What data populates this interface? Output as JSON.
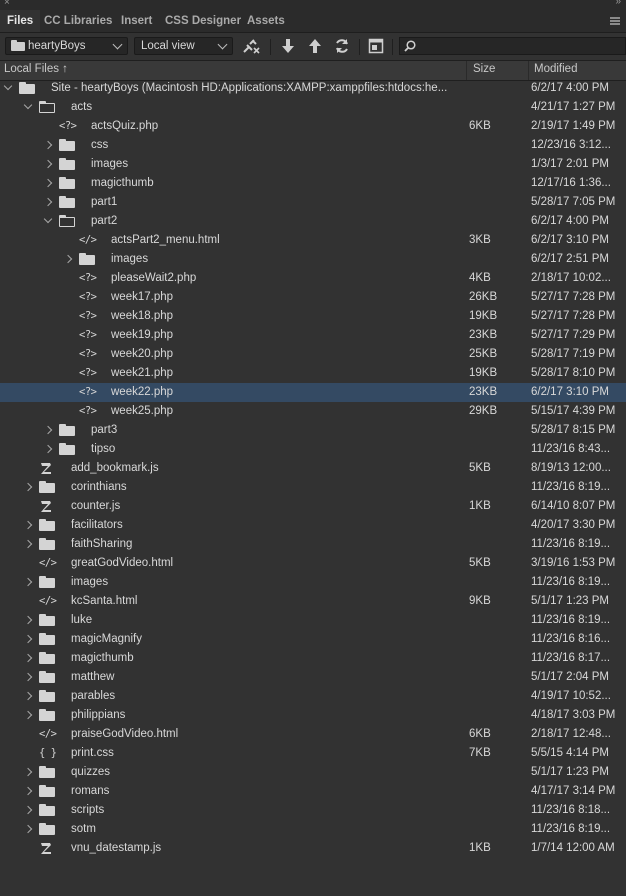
{
  "tabs": [
    "Files",
    "CC Libraries",
    "Insert",
    "CSS Designer",
    "Assets"
  ],
  "toolbar": {
    "site": "heartyBoys",
    "view": "Local view",
    "search_value": ""
  },
  "columns": {
    "local_files": "Local Files",
    "sort_arrow": "↑",
    "size": "Size",
    "modified": "Modified"
  },
  "rows": [
    {
      "name": "Site - heartyBoys (Macintosh HD:Applications:XAMPP:xamppfiles:htdocs:he...",
      "size": "",
      "modified": "6/2/17 4:00 PM",
      "icon": "site-folder-icon",
      "level": 0,
      "expand": "open"
    },
    {
      "name": "acts",
      "size": "",
      "modified": "4/21/17 1:27 PM",
      "icon": "folder-open-icon",
      "level": 1,
      "expand": "open"
    },
    {
      "name": "actsQuiz.php",
      "size": "6KB",
      "modified": "2/19/17 1:49 PM",
      "icon": "php-file-icon",
      "level": 2,
      "expand": ""
    },
    {
      "name": "css",
      "size": "",
      "modified": "12/23/16 3:12...",
      "icon": "folder-icon",
      "level": 2,
      "expand": "closed"
    },
    {
      "name": "images",
      "size": "",
      "modified": "1/3/17 2:01 PM",
      "icon": "folder-icon",
      "level": 2,
      "expand": "closed"
    },
    {
      "name": "magicthumb",
      "size": "",
      "modified": "12/17/16 1:36...",
      "icon": "folder-icon",
      "level": 2,
      "expand": "closed"
    },
    {
      "name": "part1",
      "size": "",
      "modified": "5/28/17 7:05 PM",
      "icon": "folder-icon",
      "level": 2,
      "expand": "closed"
    },
    {
      "name": "part2",
      "size": "",
      "modified": "6/2/17 4:00 PM",
      "icon": "folder-open-icon",
      "level": 2,
      "expand": "open"
    },
    {
      "name": "actsPart2_menu.html",
      "size": "3KB",
      "modified": "6/2/17 3:10 PM",
      "icon": "html-file-icon",
      "level": 3,
      "expand": ""
    },
    {
      "name": "images",
      "size": "",
      "modified": "6/2/17 2:51 PM",
      "icon": "folder-icon",
      "level": 3,
      "expand": "closed"
    },
    {
      "name": "pleaseWait2.php",
      "size": "4KB",
      "modified": "2/18/17 10:02...",
      "icon": "php-file-icon",
      "level": 3,
      "expand": ""
    },
    {
      "name": "week17.php",
      "size": "26KB",
      "modified": "5/27/17 7:28 PM",
      "icon": "php-file-icon",
      "level": 3,
      "expand": ""
    },
    {
      "name": "week18.php",
      "size": "19KB",
      "modified": "5/27/17 7:28 PM",
      "icon": "php-file-icon",
      "level": 3,
      "expand": ""
    },
    {
      "name": "week19.php",
      "size": "23KB",
      "modified": "5/27/17 7:29 PM",
      "icon": "php-file-icon",
      "level": 3,
      "expand": ""
    },
    {
      "name": "week20.php",
      "size": "25KB",
      "modified": "5/28/17 7:19 PM",
      "icon": "php-file-icon",
      "level": 3,
      "expand": ""
    },
    {
      "name": "week21.php",
      "size": "19KB",
      "modified": "5/28/17 8:10 PM",
      "icon": "php-file-icon",
      "level": 3,
      "expand": ""
    },
    {
      "name": "week22.php",
      "size": "23KB",
      "modified": "6/2/17 3:10 PM",
      "icon": "php-file-icon",
      "level": 3,
      "expand": "",
      "selected": true
    },
    {
      "name": "week25.php",
      "size": "29KB",
      "modified": "5/15/17 4:39 PM",
      "icon": "php-file-icon",
      "level": 3,
      "expand": ""
    },
    {
      "name": "part3",
      "size": "",
      "modified": "5/28/17 8:15 PM",
      "icon": "folder-icon",
      "level": 2,
      "expand": "closed"
    },
    {
      "name": "tipso",
      "size": "",
      "modified": "11/23/16 8:43...",
      "icon": "folder-icon",
      "level": 2,
      "expand": "closed"
    },
    {
      "name": "add_bookmark.js",
      "size": "5KB",
      "modified": "8/19/13 12:00...",
      "icon": "js-file-icon",
      "level": 1,
      "expand": ""
    },
    {
      "name": "corinthians",
      "size": "",
      "modified": "11/23/16 8:19...",
      "icon": "folder-icon",
      "level": 1,
      "expand": "closed"
    },
    {
      "name": "counter.js",
      "size": "1KB",
      "modified": "6/14/10 8:07 PM",
      "icon": "js-file-icon",
      "level": 1,
      "expand": ""
    },
    {
      "name": "facilitators",
      "size": "",
      "modified": "4/20/17 3:30 PM",
      "icon": "folder-icon",
      "level": 1,
      "expand": "closed"
    },
    {
      "name": "faithSharing",
      "size": "",
      "modified": "11/23/16 8:19...",
      "icon": "folder-icon",
      "level": 1,
      "expand": "closed"
    },
    {
      "name": "greatGodVideo.html",
      "size": "5KB",
      "modified": "3/19/16 1:53 PM",
      "icon": "html-file-icon",
      "level": 1,
      "expand": ""
    },
    {
      "name": "images",
      "size": "",
      "modified": "11/23/16 8:19...",
      "icon": "folder-icon",
      "level": 1,
      "expand": "closed"
    },
    {
      "name": "kcSanta.html",
      "size": "9KB",
      "modified": "5/1/17 1:23 PM",
      "icon": "html-file-icon",
      "level": 1,
      "expand": ""
    },
    {
      "name": "luke",
      "size": "",
      "modified": "11/23/16 8:19...",
      "icon": "folder-icon",
      "level": 1,
      "expand": "closed"
    },
    {
      "name": "magicMagnify",
      "size": "",
      "modified": "11/23/16 8:16...",
      "icon": "folder-icon",
      "level": 1,
      "expand": "closed"
    },
    {
      "name": "magicthumb",
      "size": "",
      "modified": "11/23/16 8:17...",
      "icon": "folder-icon",
      "level": 1,
      "expand": "closed"
    },
    {
      "name": "matthew",
      "size": "",
      "modified": "5/1/17 2:04 PM",
      "icon": "folder-icon",
      "level": 1,
      "expand": "closed"
    },
    {
      "name": "parables",
      "size": "",
      "modified": "4/19/17 10:52...",
      "icon": "folder-icon",
      "level": 1,
      "expand": "closed"
    },
    {
      "name": "philippians",
      "size": "",
      "modified": "4/18/17 3:03 PM",
      "icon": "folder-icon",
      "level": 1,
      "expand": "closed"
    },
    {
      "name": "praiseGodVideo.html",
      "size": "6KB",
      "modified": "2/18/17 12:48...",
      "icon": "html-file-icon",
      "level": 1,
      "expand": ""
    },
    {
      "name": "print.css",
      "size": "7KB",
      "modified": "5/5/15 4:14 PM",
      "icon": "css-file-icon",
      "level": 1,
      "expand": ""
    },
    {
      "name": "quizzes",
      "size": "",
      "modified": "5/1/17 1:23 PM",
      "icon": "folder-icon",
      "level": 1,
      "expand": "closed"
    },
    {
      "name": "romans",
      "size": "",
      "modified": "4/17/17 3:14 PM",
      "icon": "folder-icon",
      "level": 1,
      "expand": "closed"
    },
    {
      "name": "scripts",
      "size": "",
      "modified": "11/23/16 8:18...",
      "icon": "folder-icon",
      "level": 1,
      "expand": "closed"
    },
    {
      "name": "sotm",
      "size": "",
      "modified": "11/23/16 8:19...",
      "icon": "folder-icon",
      "level": 1,
      "expand": "closed"
    },
    {
      "name": "vnu_datestamp.js",
      "size": "1KB",
      "modified": "1/7/14 12:00 AM",
      "icon": "js-file-icon",
      "level": 1,
      "expand": ""
    }
  ]
}
